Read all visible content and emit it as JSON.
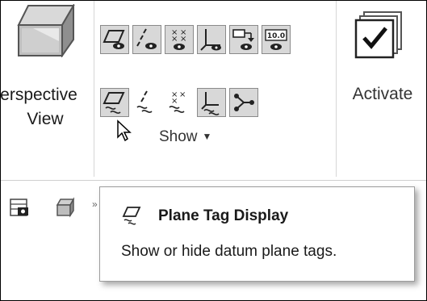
{
  "ribbon": {
    "perspective_view": {
      "label_line1": "Perspective",
      "label_line2": "View",
      "icon": "perspective-cube-icon"
    },
    "show_group": {
      "label": "Show",
      "caret": "▼",
      "row1_icons": [
        "plane-display-icon",
        "axis-display-icon",
        "points-display-icon",
        "coordinate-systems-display-icon",
        "annotations-display-icon",
        "dimensions-display-icon"
      ],
      "row2_icons": [
        "plane-tag-display-icon",
        "axis-tag-display-icon",
        "point-tag-display-icon",
        "csys-tag-display-icon",
        "spin-center-display-icon"
      ],
      "dimension_badge": "10.0"
    },
    "activate": {
      "label": "Activate",
      "icon": "activate-checkbox-icon"
    }
  },
  "toolbar": {
    "icons": [
      "save-view-icon",
      "view-cube-icon"
    ],
    "overflow": "»"
  },
  "tooltip": {
    "icon": "plane-tag-display-icon",
    "title": "Plane Tag Display",
    "description": "Show or hide datum plane tags."
  },
  "colors": {
    "active_button_bg": "#d8d8d8",
    "active_button_border": "#8a8a8a",
    "tooltip_border": "#9c9c9c",
    "separator": "#d6d6d6"
  }
}
